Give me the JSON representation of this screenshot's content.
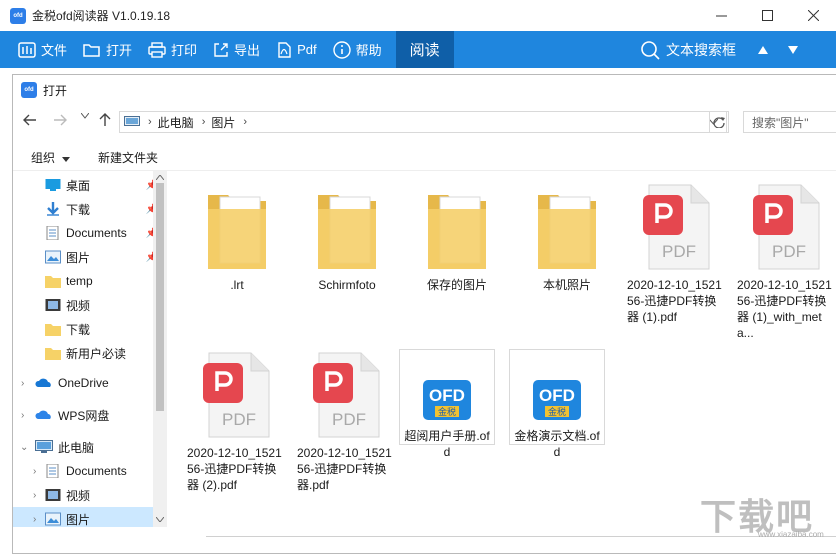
{
  "app": {
    "title": "金税ofd阅读器 V1.0.19.18",
    "logo_text": "ofd"
  },
  "toolbar": {
    "file": "文件",
    "open": "打开",
    "print": "打印",
    "export": "导出",
    "pdf": "Pdf",
    "help": "帮助",
    "read": "阅读",
    "search": "文本搜索框",
    "accent": "#1f86de"
  },
  "dialog": {
    "title": "打开",
    "breadcrumb": [
      "此电脑",
      "图片"
    ],
    "search_placeholder": "搜索\"图片\"",
    "organize": "组织",
    "new_folder": "新建文件夹"
  },
  "nav": {
    "quick": [
      {
        "label": "桌面",
        "icon": "desktop-icon",
        "pinned": true
      },
      {
        "label": "下载",
        "icon": "download-icon",
        "pinned": true
      },
      {
        "label": "Documents",
        "icon": "documents-icon",
        "pinned": true
      },
      {
        "label": "图片",
        "icon": "pictures-icon",
        "pinned": true
      },
      {
        "label": "temp",
        "icon": "folder-icon",
        "pinned": false
      },
      {
        "label": "视频",
        "icon": "video-icon",
        "pinned": false
      },
      {
        "label": "下载",
        "icon": "folder-icon",
        "pinned": false
      },
      {
        "label": "新用户必读",
        "icon": "folder-icon",
        "pinned": false
      }
    ],
    "onedrive": "OneDrive",
    "wps": "WPS网盘",
    "thispc": "此电脑",
    "pc_items": [
      {
        "label": "Documents",
        "icon": "documents-icon"
      },
      {
        "label": "视频",
        "icon": "video-icon"
      },
      {
        "label": "图片",
        "icon": "pictures-icon"
      }
    ]
  },
  "files": [
    {
      "name": ".lrt",
      "type": "folder"
    },
    {
      "name": "Schirmfoto",
      "type": "folder"
    },
    {
      "name": "保存的图片",
      "type": "folder"
    },
    {
      "name": "本机照片",
      "type": "folder"
    },
    {
      "name": "2020-12-10_152156-迅捷PDF转换器 (1).pdf",
      "type": "pdf"
    },
    {
      "name": "2020-12-10_152156-迅捷PDF转换器 (1)_with_meta...",
      "type": "pdf"
    },
    {
      "name": "2020-12-10_152156-迅捷PDF转换器 (2).pdf",
      "type": "pdf"
    },
    {
      "name": "2020-12-10_152156-迅捷PDF转换器.pdf",
      "type": "pdf"
    },
    {
      "name": "超阅用户手册.ofd",
      "type": "ofd"
    },
    {
      "name": "金格演示文档.ofd",
      "type": "ofd"
    }
  ],
  "icons": {
    "pdf_label": "PDF",
    "ofd_label": "OFD",
    "ofd_sub": "金税"
  },
  "watermark": {
    "text": "下载吧",
    "url": "www.xiazaiba.com"
  }
}
